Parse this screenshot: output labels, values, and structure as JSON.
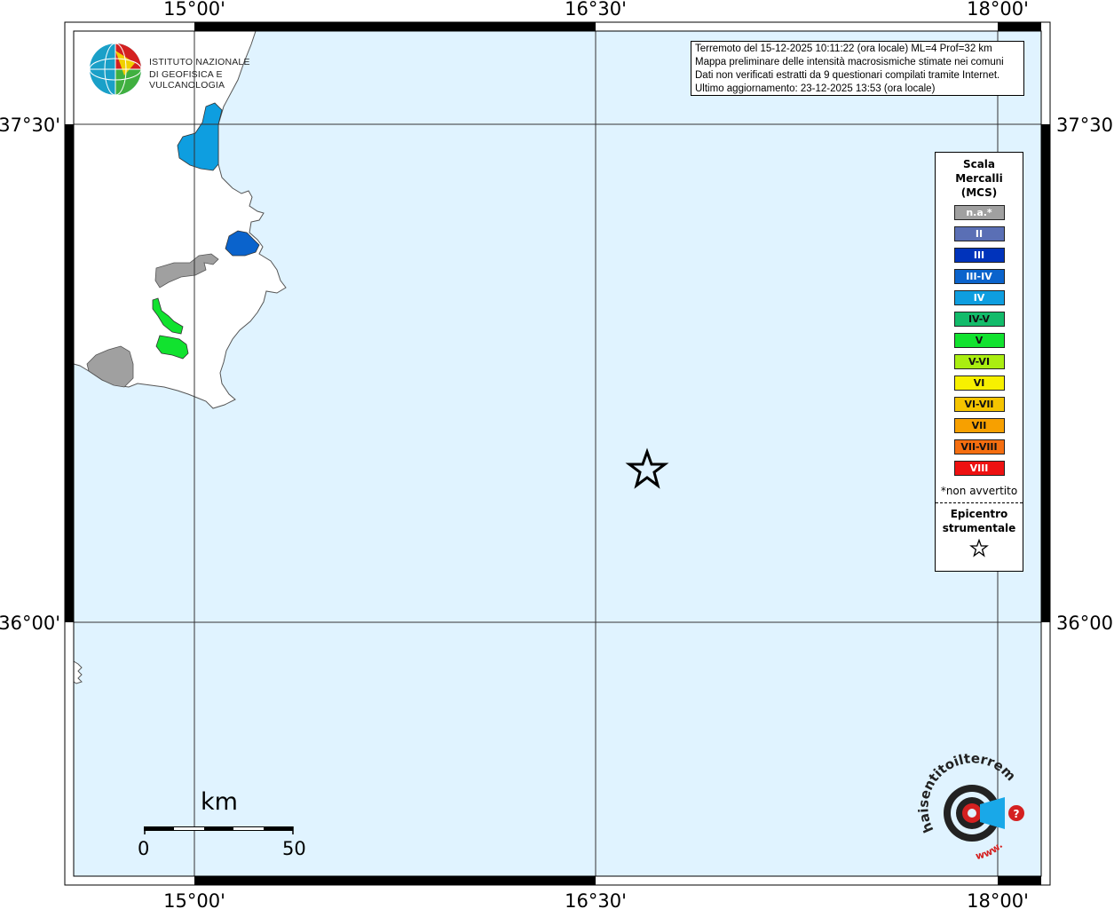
{
  "map": {
    "lon_labels": [
      "15°00'",
      "16°30'",
      "18°00'"
    ],
    "lat_labels": [
      "37°30'",
      "36°00'"
    ],
    "sea_color": "#e0f3ff",
    "land_color": "#ffffff"
  },
  "info_box": {
    "line1": "Terremoto del 15-12-2025 10:11:22 (ora locale) ML=4 Prof=32 km",
    "line2": "Mappa preliminare delle intensità macrosismiche stimate nei comuni",
    "line3": "Dati non verificati estratti da 9 questionari compilati tramite Internet.",
    "line4": "Ultimo aggiornamento: 23-12-2025 13:53 (ora locale)"
  },
  "logo": {
    "line1": "ISTITUTO NAZIONALE",
    "line2": "DI GEOFISICA E VULCANOLOGIA"
  },
  "legend": {
    "title1": "Scala",
    "title2": "Mercalli",
    "title3": "(MCS)",
    "items": [
      {
        "label": "n.a.*",
        "color": "#a0a0a0"
      },
      {
        "label": "II",
        "color": "#5a6fb5"
      },
      {
        "label": "III",
        "color": "#0033bb"
      },
      {
        "label": "III-IV",
        "color": "#0a63cc"
      },
      {
        "label": "IV",
        "color": "#0e9ee0"
      },
      {
        "label": "IV-V",
        "color": "#12bb6a"
      },
      {
        "label": "V",
        "color": "#11e22f"
      },
      {
        "label": "V-VI",
        "color": "#aaee11"
      },
      {
        "label": "VI",
        "color": "#f7f000"
      },
      {
        "label": "VI-VII",
        "color": "#f5c400"
      },
      {
        "label": "VII",
        "color": "#f7a000"
      },
      {
        "label": "VII-VIII",
        "color": "#f56e10"
      },
      {
        "label": "VIII",
        "color": "#ee1111"
      }
    ],
    "note": "*non avvertito",
    "epicenter1": "Epicentro",
    "epicenter2": "strumentale"
  },
  "scale_bar": {
    "unit": "km",
    "start": "0",
    "end": "50"
  },
  "watermark": {
    "text1": "haisentitoilterremoto.it",
    "text2": "www."
  }
}
